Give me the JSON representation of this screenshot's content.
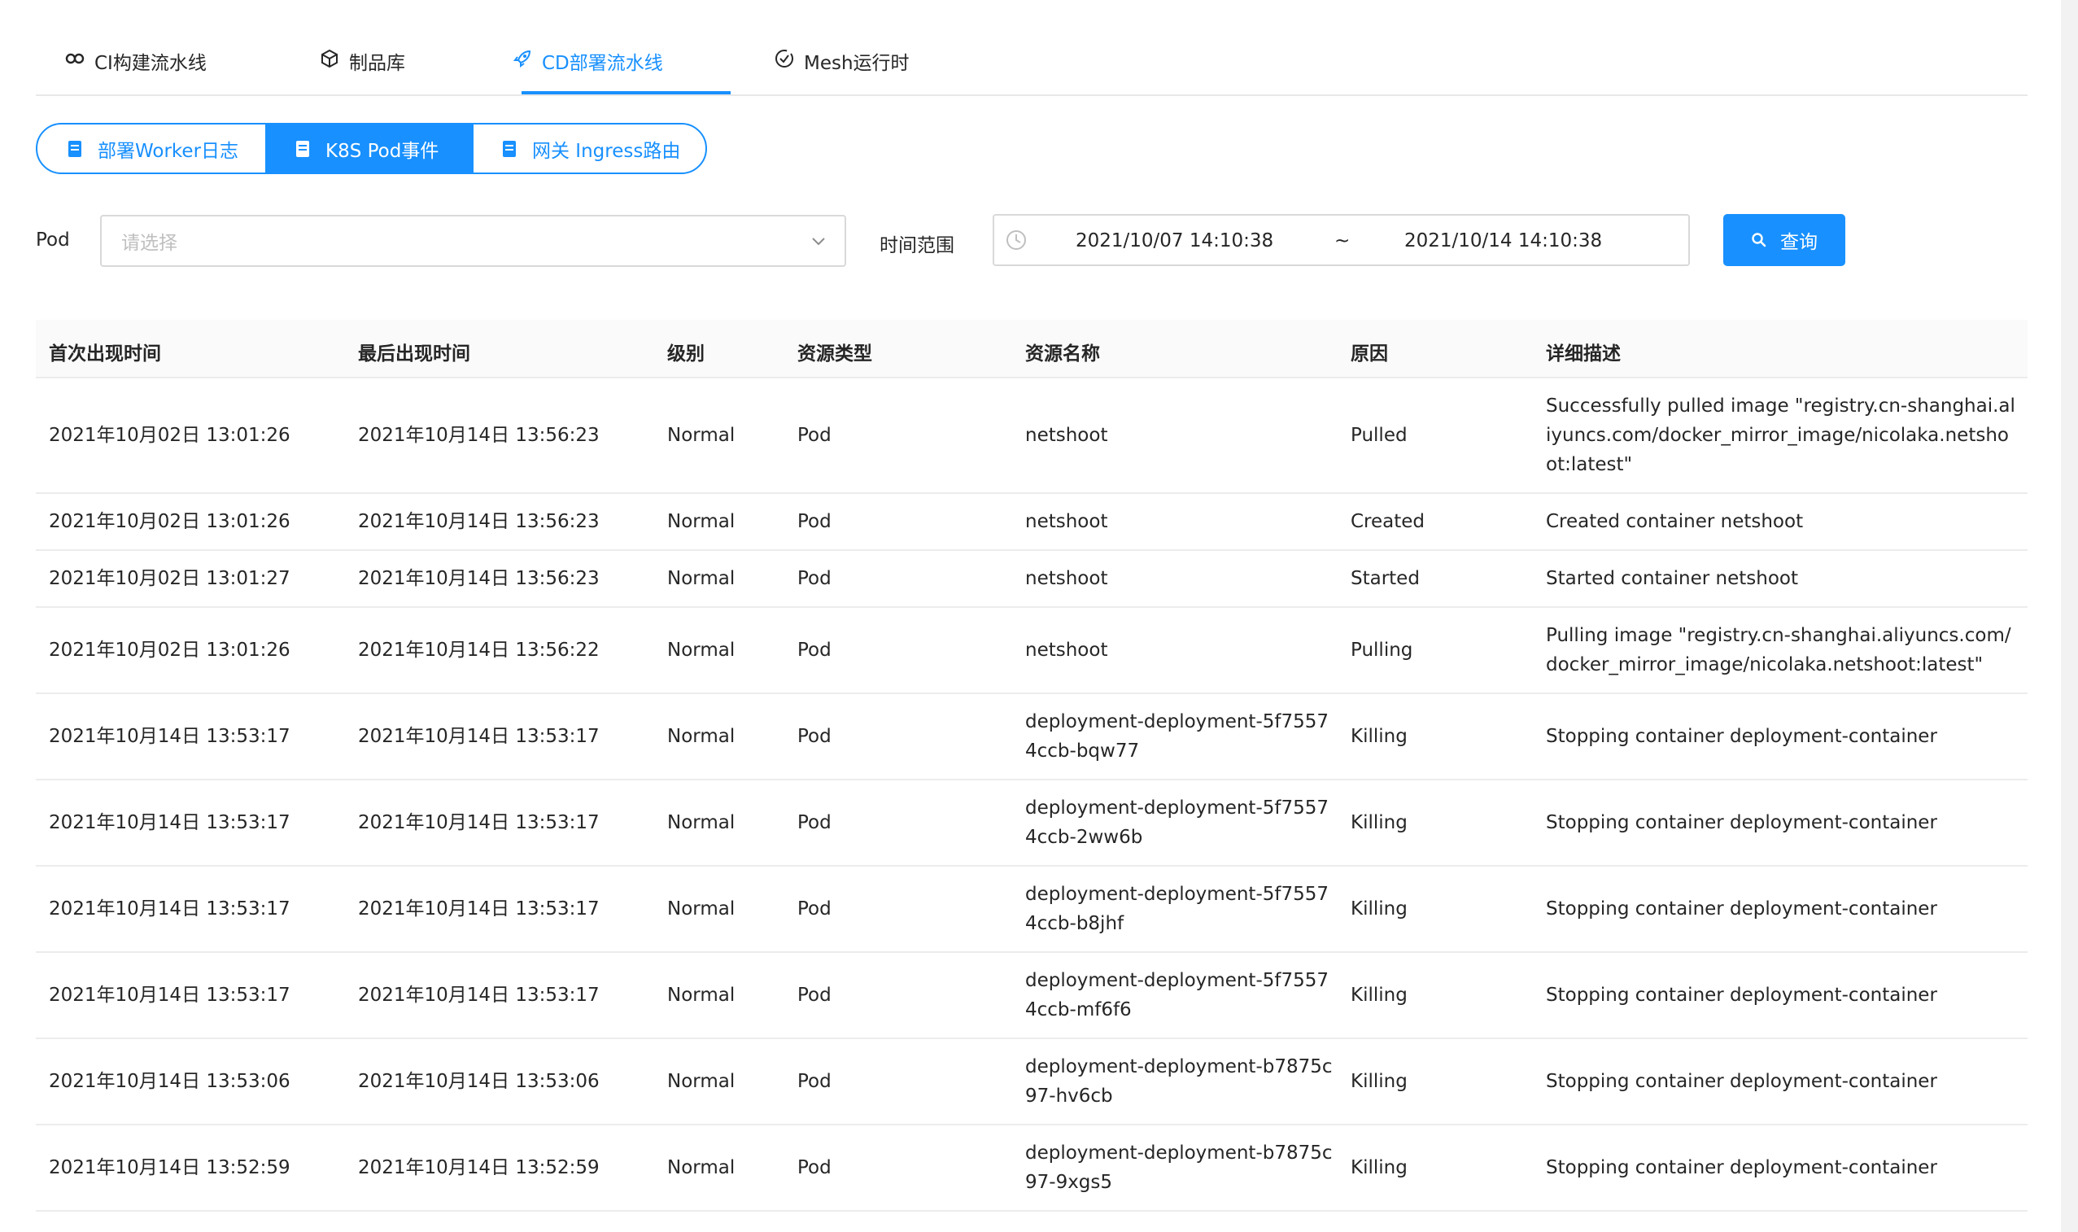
{
  "top_tabs": [
    {
      "label": "CI构建流水线",
      "icon": "link-icon"
    },
    {
      "label": "制品库",
      "icon": "cube-icon"
    },
    {
      "label": "CD部署流水线",
      "icon": "rocket-icon",
      "active": true
    },
    {
      "label": "Mesh运行时",
      "icon": "check-circle-icon"
    }
  ],
  "sub_tabs": [
    {
      "label": "部署Worker日志"
    },
    {
      "label": "K8S Pod事件",
      "active": true
    },
    {
      "label": "网关 Ingress路由"
    }
  ],
  "filters": {
    "pod_label": "Pod",
    "pod_placeholder": "请选择",
    "range_label": "时间范围",
    "range_from": "2021/10/07 14:10:38",
    "range_sep": "~",
    "range_to": "2021/10/14 14:10:38",
    "query_label": "查询"
  },
  "table": {
    "headers": [
      "首次出现时间",
      "最后出现时间",
      "级别",
      "资源类型",
      "资源名称",
      "原因",
      "详细描述"
    ],
    "rows": [
      [
        "2021年10月02日 13:01:26",
        "2021年10月14日 13:56:23",
        "Normal",
        "Pod",
        "netshoot",
        "Pulled",
        "Successfully pulled image \"registry.cn-shanghai.aliyuncs.com/docker_mirror_image/nicolaka.netshoot:latest\""
      ],
      [
        "2021年10月02日 13:01:26",
        "2021年10月14日 13:56:23",
        "Normal",
        "Pod",
        "netshoot",
        "Created",
        "Created container netshoot"
      ],
      [
        "2021年10月02日 13:01:27",
        "2021年10月14日 13:56:23",
        "Normal",
        "Pod",
        "netshoot",
        "Started",
        "Started container netshoot"
      ],
      [
        "2021年10月02日 13:01:26",
        "2021年10月14日 13:56:22",
        "Normal",
        "Pod",
        "netshoot",
        "Pulling",
        "Pulling image \"registry.cn-shanghai.aliyuncs.com/docker_mirror_image/nicolaka.netshoot:latest\""
      ],
      [
        "2021年10月14日 13:53:17",
        "2021年10月14日 13:53:17",
        "Normal",
        "Pod",
        "deployment-deployment-5f75574ccb-bqw77",
        "Killing",
        "Stopping container deployment-container"
      ],
      [
        "2021年10月14日 13:53:17",
        "2021年10月14日 13:53:17",
        "Normal",
        "Pod",
        "deployment-deployment-5f75574ccb-2ww6b",
        "Killing",
        "Stopping container deployment-container"
      ],
      [
        "2021年10月14日 13:53:17",
        "2021年10月14日 13:53:17",
        "Normal",
        "Pod",
        "deployment-deployment-5f75574ccb-b8jhf",
        "Killing",
        "Stopping container deployment-container"
      ],
      [
        "2021年10月14日 13:53:17",
        "2021年10月14日 13:53:17",
        "Normal",
        "Pod",
        "deployment-deployment-5f75574ccb-mf6f6",
        "Killing",
        "Stopping container deployment-container"
      ],
      [
        "2021年10月14日 13:53:06",
        "2021年10月14日 13:53:06",
        "Normal",
        "Pod",
        "deployment-deployment-b7875c97-hv6cb",
        "Killing",
        "Stopping container deployment-container"
      ],
      [
        "2021年10月14日 13:52:59",
        "2021年10月14日 13:52:59",
        "Normal",
        "Pod",
        "deployment-deployment-b7875c97-9xgs5",
        "Killing",
        "Stopping container deployment-container"
      ]
    ]
  },
  "colors": {
    "primary": "#1890ff",
    "border": "#d9d9d9",
    "header_bg": "#fafafa"
  }
}
